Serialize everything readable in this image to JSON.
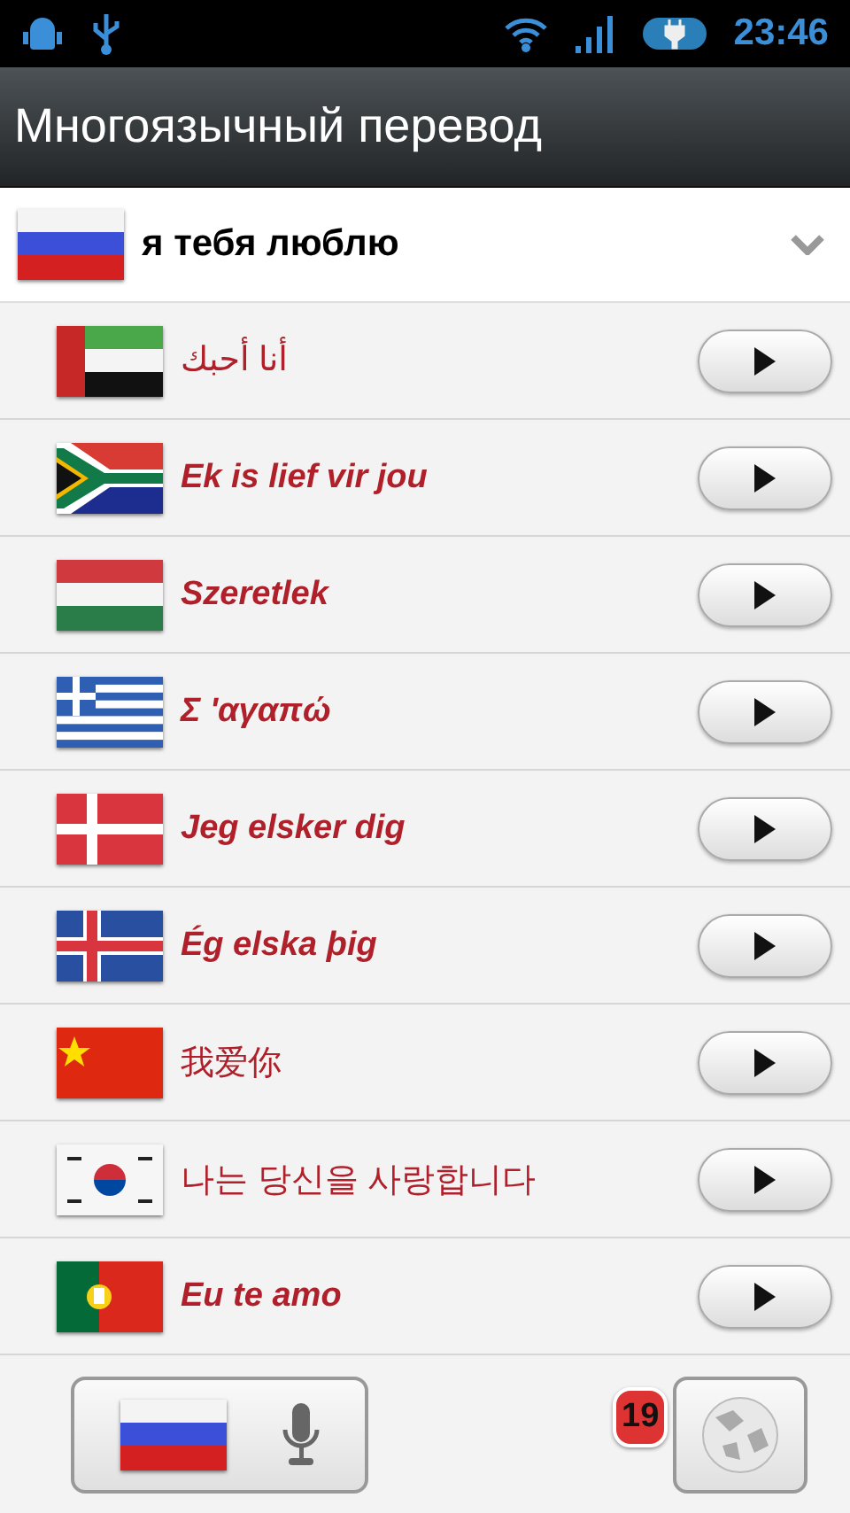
{
  "status_bar": {
    "time": "23:46"
  },
  "title": "Многоязычный перевод",
  "source": {
    "kind": "ru",
    "text": "я тебя люблю"
  },
  "translations": [
    {
      "kind": "ae",
      "text": "أنا أحبك",
      "emphasis": false
    },
    {
      "kind": "za",
      "text": "Ek is lief vir jou",
      "emphasis": true
    },
    {
      "kind": "hu",
      "text": "Szeretlek",
      "emphasis": true
    },
    {
      "kind": "gr",
      "text": "Σ 'αγαπώ",
      "emphasis": true
    },
    {
      "kind": "dk",
      "text": "Jeg elsker dig",
      "emphasis": true
    },
    {
      "kind": "is",
      "text": "Ég elska þig",
      "emphasis": true
    },
    {
      "kind": "cn",
      "text": "我爱你",
      "emphasis": false
    },
    {
      "kind": "kr",
      "text": "나는 당신을 사랑합니다",
      "emphasis": false
    },
    {
      "kind": "pt",
      "text": "Eu te amo",
      "emphasis": true
    }
  ],
  "footer": {
    "voice": {
      "kind": "ru"
    },
    "badge": "19"
  }
}
